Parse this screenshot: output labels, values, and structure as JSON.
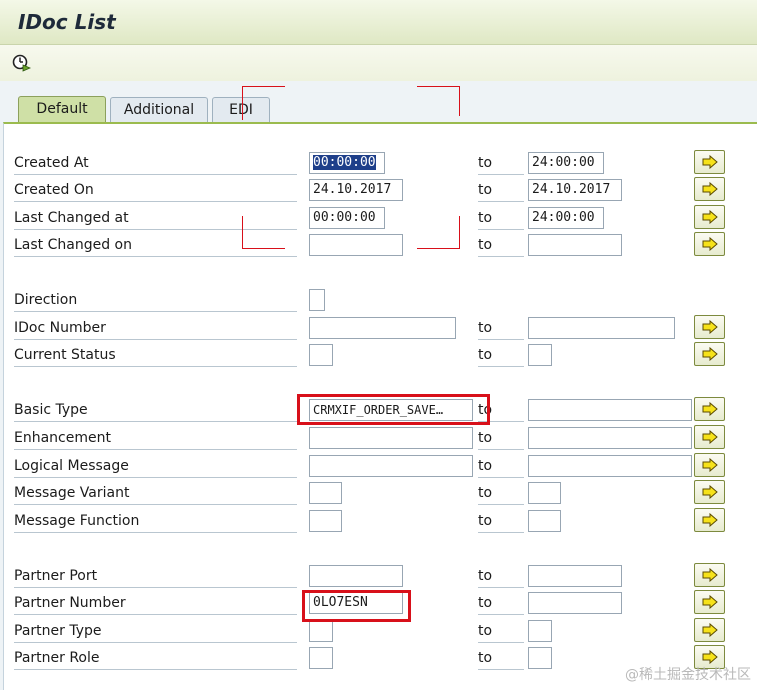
{
  "window": {
    "title": "IDoc List"
  },
  "tabs": [
    {
      "label": "Default"
    },
    {
      "label": "Additional"
    },
    {
      "label": "EDI"
    }
  ],
  "to_label": "to",
  "fields": {
    "created_at": {
      "label": "Created At",
      "from": "00:00:00",
      "to": "24:00:00"
    },
    "created_on": {
      "label": "Created On",
      "from": "24.10.2017",
      "to": "24.10.2017"
    },
    "last_changed_at": {
      "label": "Last Changed at",
      "from": "00:00:00",
      "to": "24:00:00"
    },
    "last_changed_on": {
      "label": "Last Changed on",
      "from": "",
      "to": ""
    },
    "direction": {
      "label": "Direction",
      "value": ""
    },
    "idoc_number": {
      "label": "IDoc Number",
      "from": "",
      "to": ""
    },
    "current_status": {
      "label": "Current Status",
      "from": "",
      "to": ""
    },
    "basic_type": {
      "label": "Basic Type",
      "from": "CRMXIF_ORDER_SAVE…",
      "to": ""
    },
    "enhancement": {
      "label": "Enhancement",
      "from": "",
      "to": ""
    },
    "logical_message": {
      "label": "Logical Message",
      "from": "",
      "to": ""
    },
    "message_variant": {
      "label": "Message Variant",
      "from": "",
      "to": ""
    },
    "message_function": {
      "label": "Message Function",
      "from": "",
      "to": ""
    },
    "partner_port": {
      "label": "Partner Port",
      "from": "",
      "to": ""
    },
    "partner_number": {
      "label": "Partner Number",
      "from": "0LO7ESN",
      "to": ""
    },
    "partner_type": {
      "label": "Partner Type",
      "from": "",
      "to": ""
    },
    "partner_role": {
      "label": "Partner Role",
      "from": "",
      "to": ""
    }
  },
  "watermark": "@稀土掘金技术社区",
  "colors": {
    "callout": "#d8101a",
    "active_tab": "#cfe0a6",
    "title_bar": "#dfe8c4"
  },
  "icons": {
    "execute": "execute-clock-icon",
    "multiple_selection": "multiple-selection-arrow-icon",
    "value_help": "value-help-icon"
  }
}
